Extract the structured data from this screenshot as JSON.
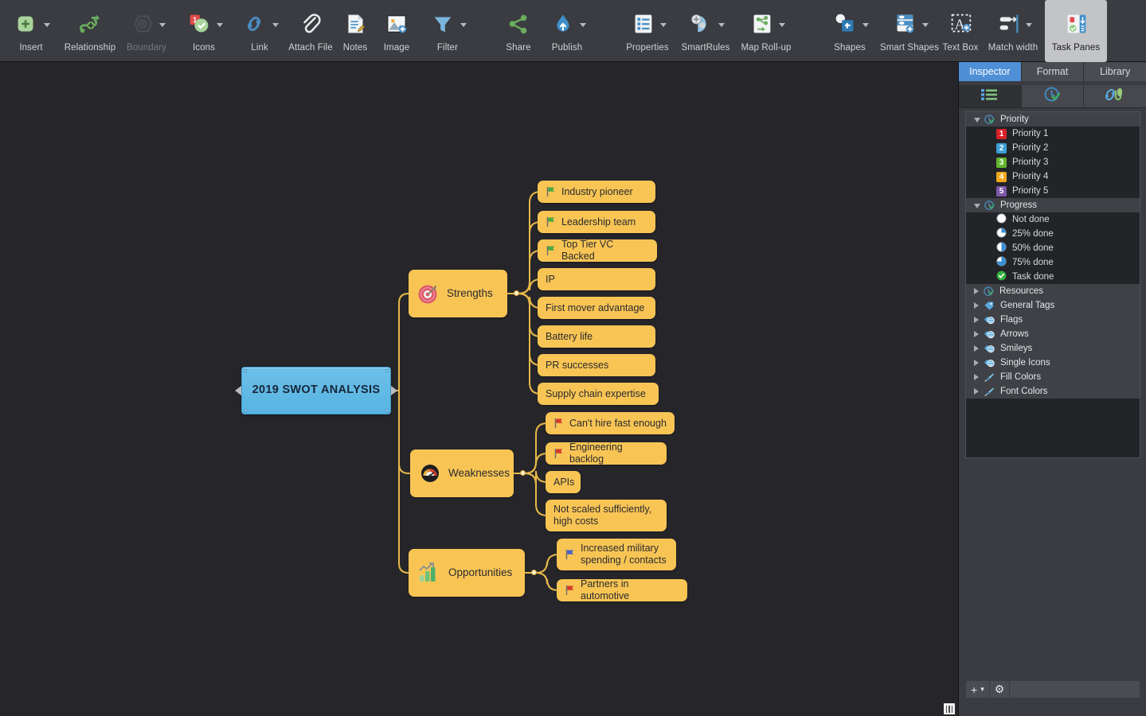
{
  "toolbar": {
    "items": [
      {
        "label": "Insert",
        "icon": "insert-node-icon",
        "caret": true,
        "dim": false,
        "active": false
      },
      {
        "label": "Relationship",
        "icon": "relationship-icon",
        "caret": false,
        "dim": false,
        "active": false
      },
      {
        "label": "Boundary",
        "icon": "boundary-icon",
        "caret": true,
        "dim": true,
        "active": false
      },
      {
        "label": "Icons",
        "icon": "icons-icon",
        "caret": true,
        "dim": false,
        "active": false
      },
      {
        "label": "Link",
        "icon": "link-icon",
        "caret": true,
        "dim": false,
        "active": false
      },
      {
        "label": "Attach File",
        "icon": "paperclip-icon",
        "caret": false,
        "dim": false,
        "active": false
      },
      {
        "label": "Notes",
        "icon": "notes-icon",
        "caret": false,
        "dim": false,
        "active": false
      },
      {
        "label": "Image",
        "icon": "image-icon",
        "caret": false,
        "dim": false,
        "active": false
      },
      {
        "label": "Filter",
        "icon": "filter-funnel-icon",
        "caret": true,
        "dim": false,
        "active": false
      },
      {
        "label": "Share",
        "icon": "share-icon",
        "caret": false,
        "dim": false,
        "active": false
      },
      {
        "label": "Publish",
        "icon": "publish-icon",
        "caret": true,
        "dim": false,
        "active": false
      },
      {
        "label": "Properties",
        "icon": "properties-icon",
        "caret": true,
        "dim": false,
        "active": false
      },
      {
        "label": "SmartRules",
        "icon": "smartrules-icon",
        "caret": true,
        "dim": false,
        "active": false
      },
      {
        "label": "Map Roll-up",
        "icon": "map-rollup-icon",
        "caret": true,
        "dim": false,
        "active": false
      },
      {
        "label": "Shapes",
        "icon": "shapes-icon",
        "caret": true,
        "dim": false,
        "active": false
      },
      {
        "label": "Smart Shapes",
        "icon": "smart-shapes-icon",
        "caret": true,
        "dim": false,
        "active": false
      },
      {
        "label": "Text Box",
        "icon": "text-box-icon",
        "caret": false,
        "dim": false,
        "active": false
      },
      {
        "label": "Match width",
        "icon": "match-width-icon",
        "caret": true,
        "dim": false,
        "active": false
      },
      {
        "label": "Task Panes",
        "icon": "task-panes-icon",
        "caret": false,
        "dim": false,
        "active": true
      }
    ]
  },
  "map": {
    "root": {
      "text": "2019 SWOT ANALYSIS",
      "selected": true
    },
    "branches": [
      {
        "text": "Strengths",
        "icon": "target-dartboard-icon",
        "children": [
          {
            "text": "Industry pioneer",
            "flag": "green"
          },
          {
            "text": "Leadership team",
            "flag": "green"
          },
          {
            "text": "Top Tier VC Backed",
            "flag": "green"
          },
          {
            "text": "IP",
            "flag": null
          },
          {
            "text": "First mover advantage",
            "flag": null
          },
          {
            "text": "Battery life",
            "flag": null
          },
          {
            "text": "PR successes",
            "flag": null
          },
          {
            "text": "Supply chain expertise",
            "flag": null
          }
        ]
      },
      {
        "text": "Weaknesses",
        "icon": "gauge-meter-icon",
        "children": [
          {
            "text": "Can't hire fast enough",
            "flag": "red"
          },
          {
            "text": "Engineering backlog",
            "flag": "red"
          },
          {
            "text": "APIs",
            "flag": null
          },
          {
            "text": "Not scaled sufficiently,\nhigh costs",
            "flag": null
          }
        ]
      },
      {
        "text": "Opportunities",
        "icon": "growth-bar-chart-icon",
        "children": [
          {
            "text": "Increased military\nspending / contacts",
            "flag": "blue"
          },
          {
            "text": "Partners in automotive",
            "flag": "red"
          }
        ]
      }
    ],
    "colors": {
      "node_fill": "#f8c555",
      "root_fill": "#58b4e2",
      "canvas_bg": "#26262a",
      "connector": "#e8b94a"
    }
  },
  "inspector": {
    "tabs": [
      {
        "label": "Inspector",
        "active": true
      },
      {
        "label": "Format",
        "active": false
      },
      {
        "label": "Library",
        "active": false
      }
    ],
    "icon_tabs": [
      {
        "name": "list-icon",
        "active": true
      },
      {
        "name": "clock-check-icon",
        "active": false
      },
      {
        "name": "link-attachment-icon",
        "active": false
      }
    ],
    "tree": [
      {
        "type": "group",
        "label": "Priority",
        "expanded": true,
        "icon": "clock-check-icon"
      },
      {
        "type": "item",
        "label": "Priority 1",
        "badge": "1",
        "color": "#d81f26"
      },
      {
        "type": "item",
        "label": "Priority 2",
        "badge": "2",
        "color": "#3a9fd4"
      },
      {
        "type": "item",
        "label": "Priority 3",
        "badge": "3",
        "color": "#63b72e"
      },
      {
        "type": "item",
        "label": "Priority 4",
        "badge": "4",
        "color": "#f2a81c"
      },
      {
        "type": "item",
        "label": "Priority 5",
        "badge": "5",
        "color": "#7d56a8"
      },
      {
        "type": "group",
        "label": "Progress",
        "expanded": true,
        "icon": "clock-check-icon"
      },
      {
        "type": "item",
        "label": "Not done",
        "pie": 0,
        "color": "#ffffff"
      },
      {
        "type": "item",
        "label": "25% done",
        "pie": 25,
        "color": "#3a8fd4"
      },
      {
        "type": "item",
        "label": "50% done",
        "pie": 50,
        "color": "#3a8fd4"
      },
      {
        "type": "item",
        "label": "75% done",
        "pie": 75,
        "color": "#3a8fd4"
      },
      {
        "type": "item",
        "label": "Task done",
        "pie": 100,
        "color": "#35b13e"
      },
      {
        "type": "group",
        "label": "Resources",
        "expanded": false,
        "icon": "clock-check-icon"
      },
      {
        "type": "group",
        "label": "General Tags",
        "expanded": false,
        "icon": "tag-icon"
      },
      {
        "type": "group",
        "label": "Flags",
        "expanded": false,
        "icon": "smiley-icon"
      },
      {
        "type": "group",
        "label": "Arrows",
        "expanded": false,
        "icon": "smiley-icon"
      },
      {
        "type": "group",
        "label": "Smileys",
        "expanded": false,
        "icon": "smiley-icon"
      },
      {
        "type": "group",
        "label": "Single Icons",
        "expanded": false,
        "icon": "smiley-icon"
      },
      {
        "type": "group",
        "label": "Fill Colors",
        "expanded": false,
        "icon": "paintbrush-icon"
      },
      {
        "type": "group",
        "label": "Font Colors",
        "expanded": false,
        "icon": "paintbrush-icon"
      }
    ],
    "footer": {
      "add_label": "+",
      "add_caret": "⌄",
      "gear_label": "⚙"
    }
  }
}
